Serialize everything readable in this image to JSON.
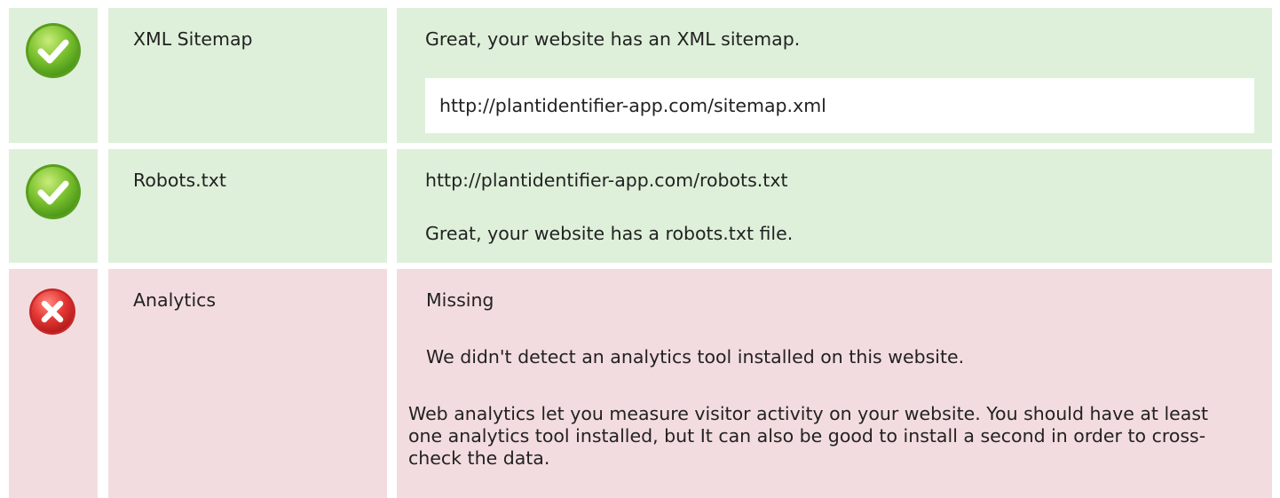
{
  "checks": [
    {
      "status": "pass",
      "icon": "check-icon",
      "label": "XML Sitemap",
      "message": "Great, your website has an XML sitemap.",
      "url": "http://plantidentifier-app.com/sitemap.xml"
    },
    {
      "status": "pass",
      "icon": "check-icon",
      "label": "Robots.txt",
      "url": "http://plantidentifier-app.com/robots.txt",
      "message": "Great, your website has a robots.txt file."
    },
    {
      "status": "fail",
      "icon": "close-icon",
      "label": "Analytics",
      "value": "Missing",
      "message": "We didn't detect an analytics tool installed on this website.",
      "description": "Web analytics let you measure visitor activity on your website. You should have at least one analytics tool installed, but It can also be good to install a second in order to cross-check the data."
    }
  ],
  "colors": {
    "pass_bg": "#def0da",
    "fail_bg": "#f3dcdf",
    "pass_icon": "#6fb72c",
    "fail_icon": "#e03636"
  }
}
